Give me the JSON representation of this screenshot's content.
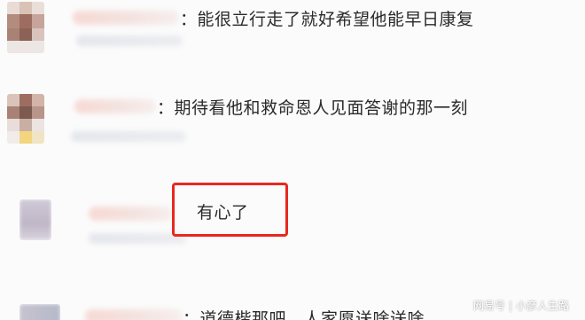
{
  "comments": [
    {
      "text": "：能很立行走了就好希望他能早日康复"
    },
    {
      "text": "：期待看他和救命恩人见面答谢的那一刻"
    },
    {
      "text": "有心了"
    },
    {
      "text": "：道德楷那吧，人家愿送啥送啥"
    }
  ],
  "highlight_color": "#e8281f",
  "watermark": {
    "source": "网易号",
    "separator": "|",
    "author": "小彦人生路"
  }
}
